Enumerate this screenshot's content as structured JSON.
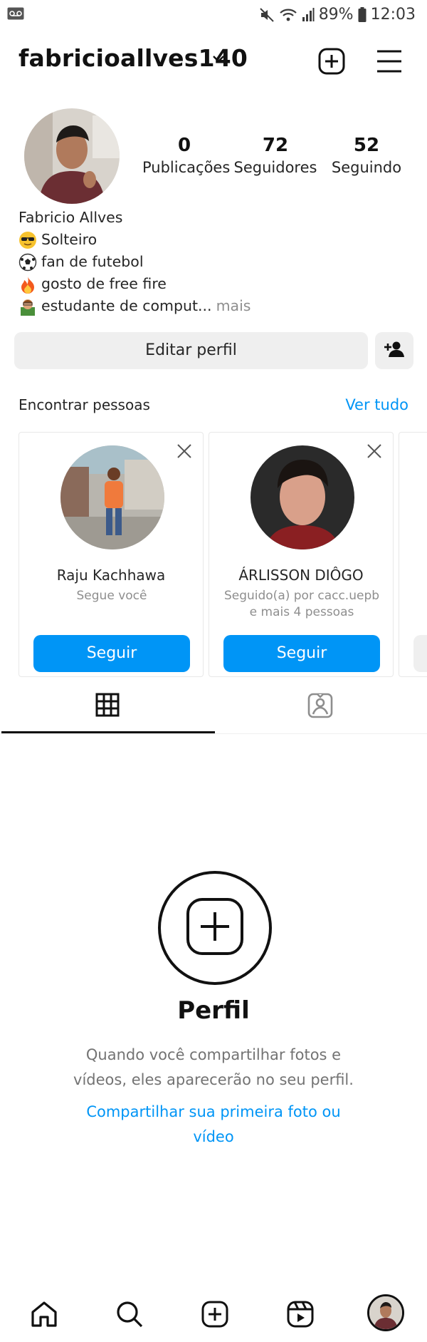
{
  "status_bar": {
    "battery": "89%",
    "time": "12:03",
    "icons": [
      "voicemail-icon",
      "mute-icon",
      "wifi-icon",
      "signal-icon",
      "battery-icon"
    ]
  },
  "header": {
    "username": "fabricioallves140",
    "icons": [
      "chevron-down-icon",
      "new-post-icon",
      "menu-icon"
    ]
  },
  "profile": {
    "stats": [
      {
        "value": "0",
        "label": "Publicações"
      },
      {
        "value": "72",
        "label": "Seguidores"
      },
      {
        "value": "52",
        "label": "Seguindo"
      }
    ],
    "full_name": "Fabricio Allves",
    "bio_lines": [
      {
        "emoji": "sunglasses-emoji",
        "text": "Solteiro"
      },
      {
        "emoji": "soccer-ball-emoji",
        "text": "fan de futebol"
      },
      {
        "emoji": "fire-emoji",
        "text": "gosto de free fire"
      },
      {
        "emoji": "student-emoji",
        "text": "estudante de comput..."
      }
    ],
    "more_label": "mais",
    "edit_button": "Editar perfil"
  },
  "suggestions": {
    "title": "Encontrar pessoas",
    "see_all": "Ver tudo",
    "cards": [
      {
        "name": "Raju Kachhawa",
        "subtitle": "Segue você",
        "button": "Seguir"
      },
      {
        "name": "ÁRLISSON DIÔGO",
        "subtitle": "Seguido(a) por cacc.uepb e mais 4 pessoas",
        "button": "Seguir"
      }
    ]
  },
  "tabs": {
    "active": "grid",
    "icons": [
      "grid-icon",
      "tagged-icon"
    ]
  },
  "empty_state": {
    "title": "Perfil",
    "description": "Quando você compartilhar fotos e vídeos, eles aparecerão no seu perfil.",
    "link": "Compartilhar sua primeira foto ou vídeo"
  },
  "bottom_nav": {
    "icons": [
      "home-icon",
      "search-icon",
      "create-icon",
      "reels-icon",
      "profile-avatar"
    ]
  },
  "colors": {
    "accent": "#0095f6",
    "button_gray": "#efefef",
    "text": "#262626",
    "muted": "#8e8e8e"
  }
}
